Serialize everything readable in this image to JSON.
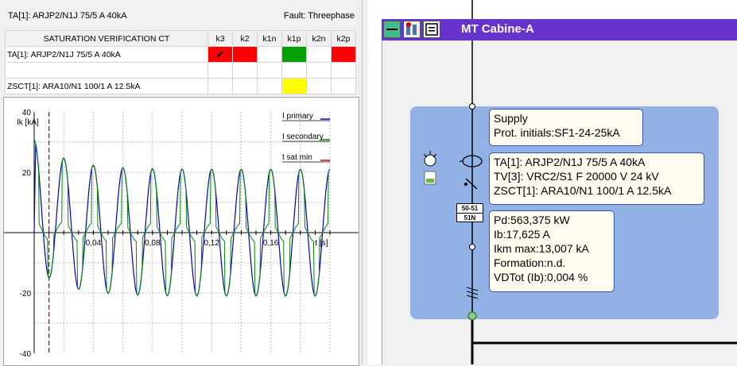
{
  "header": {
    "ct_title": "TA[1]: ARJP2/N1J 75/5 A 40kA",
    "fault": "Fault: Threephase"
  },
  "table": {
    "title": "SATURATION VERIFICATION CT",
    "columns": [
      "k3",
      "k2",
      "k1n",
      "k1p",
      "k2n",
      "k2p"
    ],
    "rows": [
      {
        "name": "TA[1]: ARJP2/N1J 75/5 A 40kA",
        "cells": [
          "red-check",
          "red",
          "",
          "green",
          "",
          "red"
        ]
      },
      {
        "name": "",
        "cells": [
          "",
          "",
          "",
          "",
          "",
          ""
        ]
      },
      {
        "name": "ZSCT[1]: ARA10/N1 100/1 A 12.5kA",
        "cells": [
          "",
          "",
          "",
          "yellow",
          "",
          ""
        ]
      }
    ],
    "check_glyph": "✔",
    "colors": {
      "red": "#ff0000",
      "green": "#00a000",
      "yellow": "#ffff00"
    }
  },
  "chart_data": {
    "type": "line",
    "ylabel": "Ik [kA]",
    "xlabel": "t [s]",
    "ylim": [
      -40,
      40
    ],
    "xlim": [
      0,
      0.2
    ],
    "y_ticks": [
      "40",
      "20",
      "-20",
      "-40"
    ],
    "x_ticks": [
      "0,04",
      "0,08",
      "0,12",
      "0,16"
    ],
    "t_sat_min": 0.01,
    "grid": true,
    "series": [
      {
        "name": "I primary",
        "color": "#0000cc",
        "peak_first": 31,
        "amplitude": 21,
        "offset_decay": 0.02,
        "frequency_hz": 50
      },
      {
        "name": "I secondary",
        "color": "#008800"
      },
      {
        "name": "t sat min",
        "color": "#cc0000"
      }
    ]
  },
  "diagram": {
    "window_title": "MT Cabine-A",
    "supply_lines": [
      "Supply",
      "Prot. initials:SF1-24-25kA"
    ],
    "equipment_lines": [
      "TA[1]: ARJP2/N1J 75/5 A 40kA",
      "TV[3]: VRC2/S1 F 20000 V 24 kV",
      "ZSCT[1]: ARA10/N1 100/1 A 12.5kA"
    ],
    "load_lines": [
      "Pd:563,375 kW",
      "Ib:17,625 A",
      "Ikm max:13,007 kA",
      "Formation:n.d.",
      "VDTot (Ib):0,004 %"
    ],
    "protection_badge": [
      "50-51",
      "51N"
    ],
    "panel_color": "#92b2e6",
    "titlebar_color": "#6633cc"
  }
}
